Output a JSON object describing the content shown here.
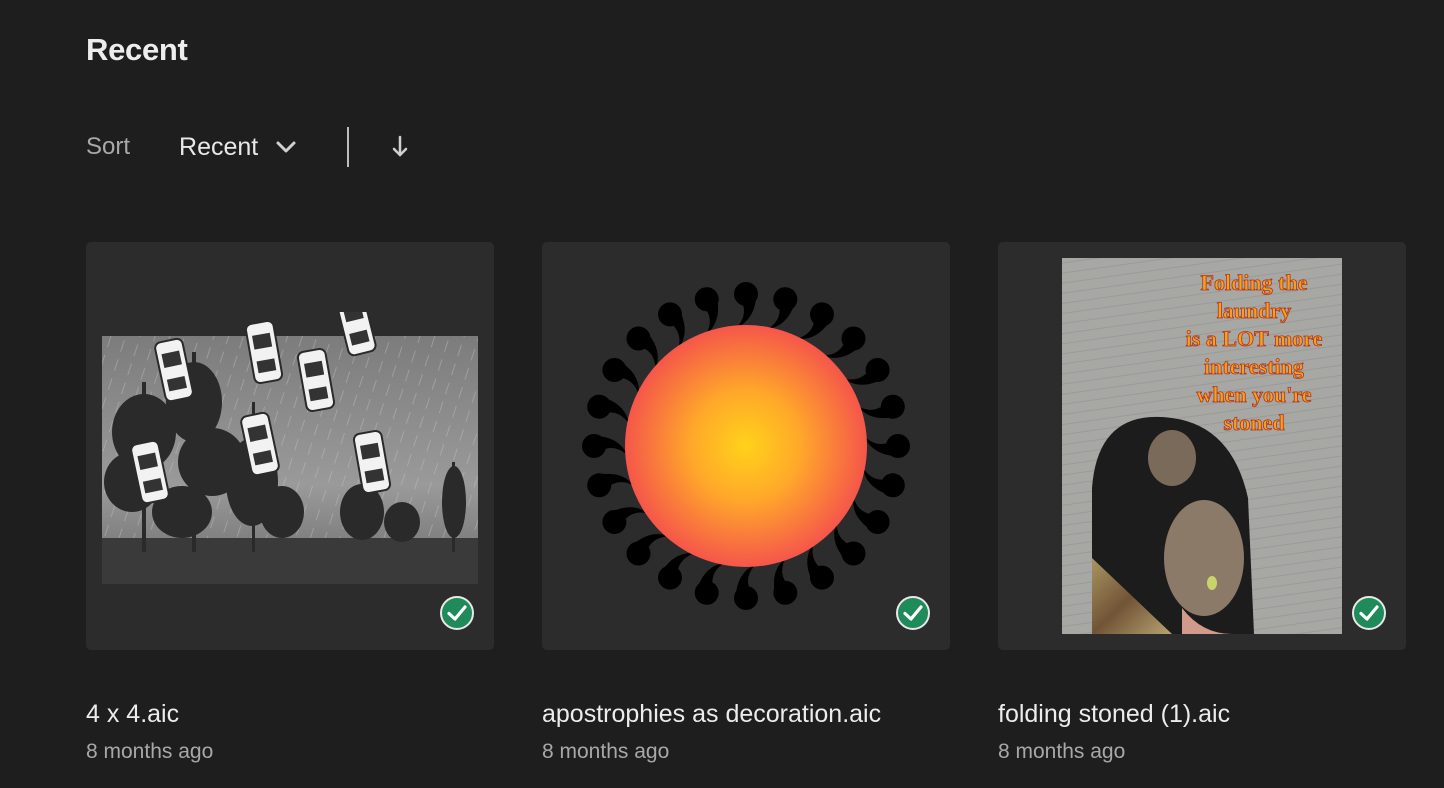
{
  "page": {
    "title": "Recent"
  },
  "sort": {
    "label": "Sort",
    "value": "Recent",
    "dropdown_icon": "chevron-down-icon",
    "direction_icon": "arrow-down-icon"
  },
  "files": [
    {
      "name": "4 x 4.aic",
      "modified": "8 months ago",
      "status_icon": "synced-check-icon"
    },
    {
      "name": "apostrophies as decoration.aic",
      "modified": "8 months ago",
      "status_icon": "synced-check-icon"
    },
    {
      "name": "folding stoned (1).aic",
      "modified": "8 months ago",
      "status_icon": "synced-check-icon",
      "thumbnail_text": [
        "Folding the",
        "laundry",
        "is a LOT more",
        "interesting",
        "when you're",
        "stoned"
      ]
    }
  ],
  "colors": {
    "background": "#1e1e1e",
    "card": "#2c2c2c",
    "sync_check": "#1f8a5a"
  }
}
